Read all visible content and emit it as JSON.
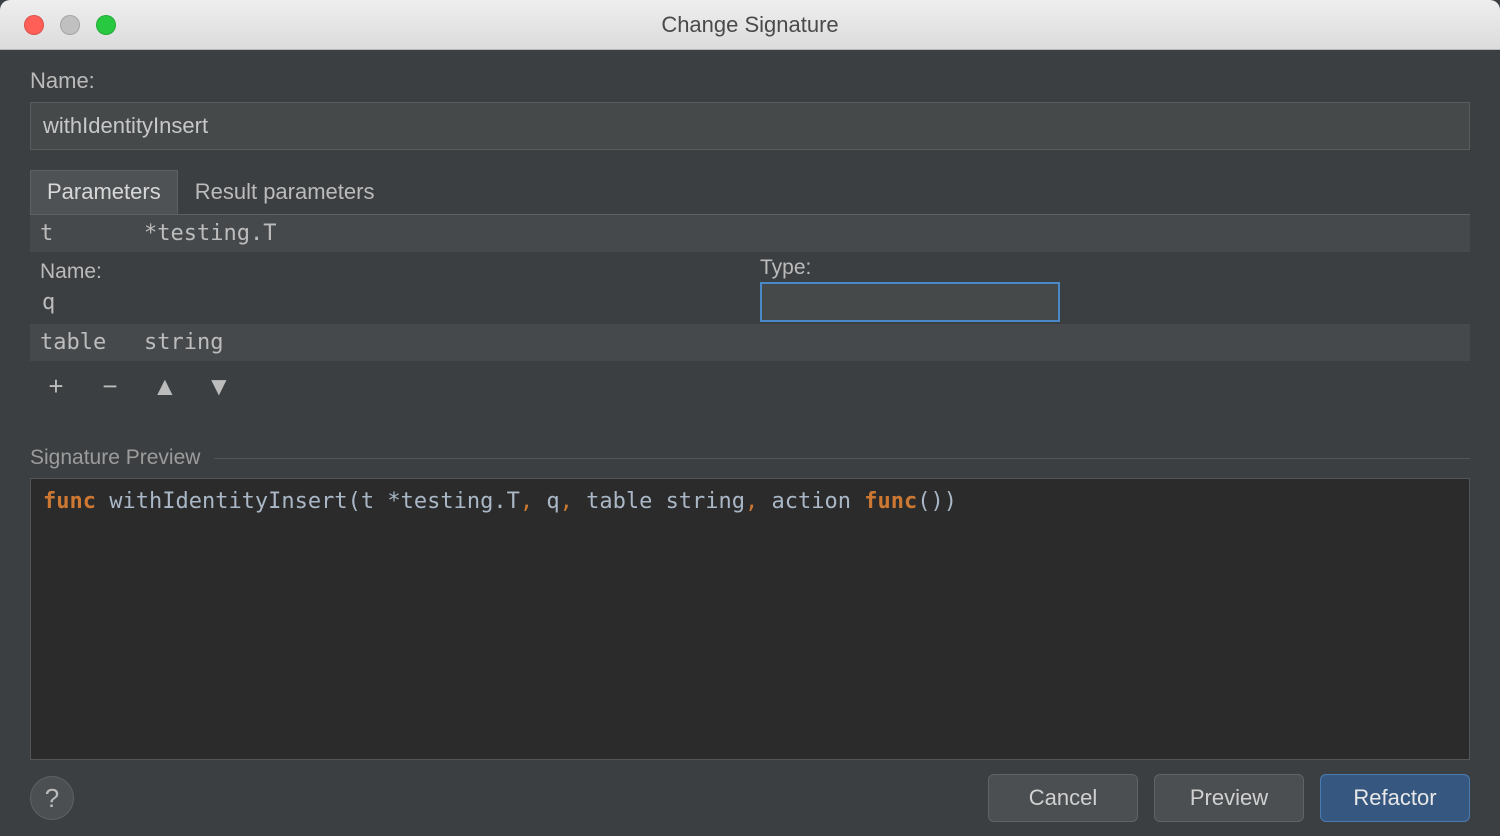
{
  "window": {
    "title": "Change Signature"
  },
  "name": {
    "label": "Name:",
    "value": "withIdentityInsert"
  },
  "tabs": {
    "parameters": "Parameters",
    "result": "Result parameters",
    "active": "parameters"
  },
  "param_editor": {
    "name_label": "Name:",
    "type_label": "Type:",
    "editing_name": "q",
    "editing_type": ""
  },
  "parameters": [
    {
      "name": "t",
      "type": "*testing.T"
    },
    {
      "name": "q",
      "type": ""
    },
    {
      "name": "table",
      "type": "string"
    }
  ],
  "toolbar": {
    "add": "+",
    "remove": "−",
    "up": "▲",
    "down": "▼"
  },
  "signature": {
    "title": "Signature Preview",
    "tokens": [
      {
        "t": "func ",
        "c": "kw"
      },
      {
        "t": "withIdentityInsert(t *testing.T",
        "c": "id"
      },
      {
        "t": ", ",
        "c": "pun"
      },
      {
        "t": "q",
        "c": "id"
      },
      {
        "t": ", ",
        "c": "pun"
      },
      {
        "t": "table string",
        "c": "id"
      },
      {
        "t": ", ",
        "c": "pun"
      },
      {
        "t": "action ",
        "c": "id"
      },
      {
        "t": "func",
        "c": "kw"
      },
      {
        "t": "())",
        "c": "id"
      }
    ]
  },
  "buttons": {
    "help": "?",
    "cancel": "Cancel",
    "preview": "Preview",
    "refactor": "Refactor"
  }
}
